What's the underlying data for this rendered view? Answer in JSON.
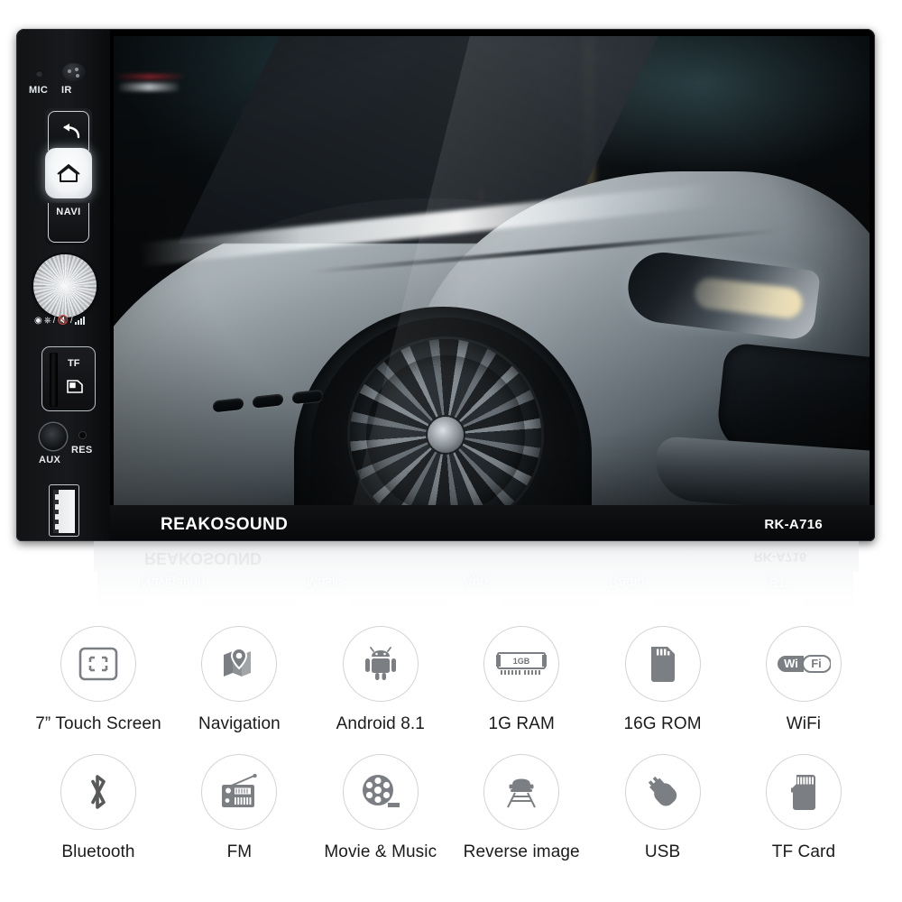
{
  "device": {
    "brand": "REAKOSOUND",
    "model": "RK-A716",
    "faceplate": {
      "mic_label": "MIC",
      "ir_label": "IR",
      "navi_label": "NAVI",
      "tf_label": "TF",
      "aux_label": "AUX",
      "res_label": "RES",
      "back_icon": "back-arrow-icon",
      "home_icon": "home-icon",
      "knob_icon": "power-mute-volume-icon",
      "tf_card_icon": "sd-card-icon",
      "usb_icon": "usb-port-icon"
    },
    "screen_image": "silver-sports-car-front-quarter"
  },
  "reflection": {
    "brand": "REAKOSOUND",
    "model": "RK-A716",
    "menu_items": [
      "Navigation",
      "Music",
      "App",
      "Radio",
      "BT"
    ]
  },
  "features": {
    "row1": [
      {
        "label": "7” Touch Screen",
        "icon": "touch-screen-icon"
      },
      {
        "label": "Navigation",
        "icon": "map-pin-icon"
      },
      {
        "label": "Android 8.1",
        "icon": "android-robot-icon"
      },
      {
        "label": "1G RAM",
        "icon": "ram-module-icon",
        "icon_text": "1GB"
      },
      {
        "label": "16G ROM",
        "icon": "memory-card-icon"
      },
      {
        "label": "WiFi",
        "icon": "wifi-badge-icon",
        "icon_text_1": "Wi",
        "icon_text_2": "Fi"
      }
    ],
    "row2": [
      {
        "label": "Bluetooth",
        "icon": "bluetooth-icon"
      },
      {
        "label": "FM",
        "icon": "radio-icon"
      },
      {
        "label": "Movie & Music",
        "icon": "film-reel-icon"
      },
      {
        "label": "Reverse image",
        "icon": "reverse-camera-car-icon"
      },
      {
        "label": "USB",
        "icon": "usb-flash-drive-icon"
      },
      {
        "label": "TF Card",
        "icon": "tf-card-icon"
      }
    ]
  },
  "colors": {
    "icon_gray": "#7b7f83",
    "circle_border": "#d2d4d6",
    "label_text": "#1b1b1b",
    "device_black": "#0c0d0f",
    "screen_teal": "#5ab4cd"
  }
}
